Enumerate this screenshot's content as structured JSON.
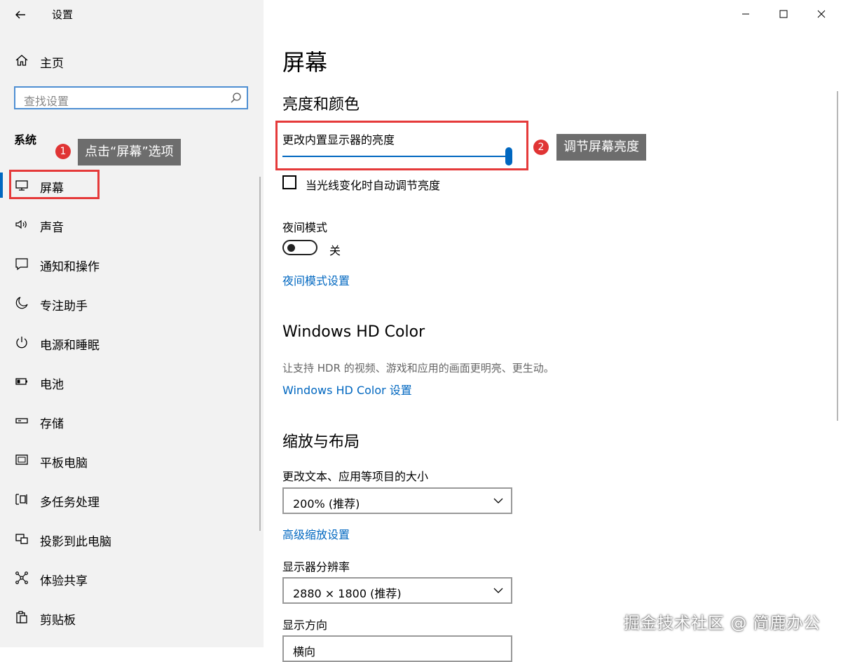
{
  "window": {
    "title": "设置",
    "controls": [
      "minimize-icon",
      "maximize-icon",
      "close-icon"
    ]
  },
  "sidebar": {
    "home_label": "主页",
    "search_placeholder": "查找设置",
    "section": "系统",
    "items": [
      {
        "label": "屏幕",
        "icon": "monitor-icon",
        "active": true
      },
      {
        "label": "声音",
        "icon": "speaker-icon"
      },
      {
        "label": "通知和操作",
        "icon": "message-icon"
      },
      {
        "label": "专注助手",
        "icon": "moon-icon"
      },
      {
        "label": "电源和睡眠",
        "icon": "power-icon"
      },
      {
        "label": "电池",
        "icon": "battery-icon"
      },
      {
        "label": "存储",
        "icon": "storage-icon"
      },
      {
        "label": "平板电脑",
        "icon": "tablet-icon"
      },
      {
        "label": "多任务处理",
        "icon": "multitask-icon"
      },
      {
        "label": "投影到此电脑",
        "icon": "project-icon"
      },
      {
        "label": "体验共享",
        "icon": "share-icon"
      },
      {
        "label": "剪贴板",
        "icon": "clipboard-icon"
      }
    ]
  },
  "annotations": {
    "step1_num": "1",
    "step1_text": "点击“屏幕”选项",
    "step2_num": "2",
    "step2_text": "调节屏幕亮度",
    "accent": "#e53a3a"
  },
  "main": {
    "title": "屏幕",
    "brightness_heading": "亮度和颜色",
    "brightness_label": "更改内置显示器的亮度",
    "brightness_value": 1.0,
    "auto_brightness_label": "当光线变化时自动调节亮度",
    "night_mode_label": "夜间模式",
    "night_mode_state": "关",
    "night_mode_link": "夜间模式设置",
    "hdr_heading": "Windows HD Color",
    "hdr_desc": "让支持 HDR 的视频、游戏和应用的画面更明亮、更生动。",
    "hdr_link": "Windows HD Color 设置",
    "scale_heading": "缩放与布局",
    "scale_label": "更改文本、应用等项目的大小",
    "scale_value": "200% (推荐)",
    "scale_link": "高级缩放设置",
    "resolution_label": "显示器分辨率",
    "resolution_value": "2880 × 1800 (推荐)",
    "orientation_label": "显示方向",
    "orientation_value": "横向"
  },
  "watermark": "掘金技术社区 @ 简鹿办公",
  "colors": {
    "accent": "#0067c0",
    "sidebar_bg": "#f2f2f2",
    "annotation": "#e53a3a"
  }
}
